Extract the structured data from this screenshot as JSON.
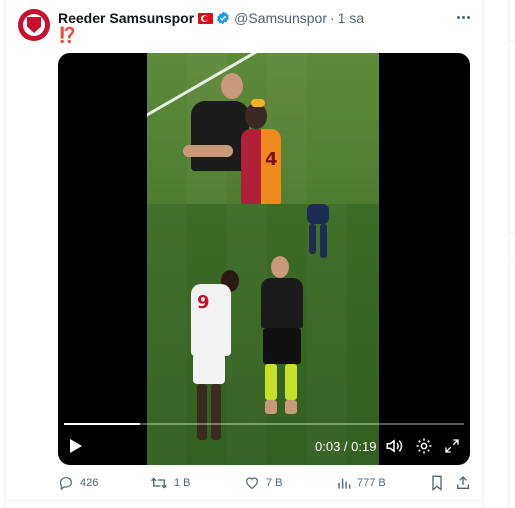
{
  "tweet": {
    "display_name": "Reeder Samsunspor",
    "handle": "@Samsunspor",
    "separator": "·",
    "time": "1 sa",
    "text": "⁉️",
    "flag_icon": "turkey-flag-icon",
    "verified_icon": "verified-badge-icon",
    "accent_color": "#1d9bf0"
  },
  "video": {
    "time_readout": "0:03 / 0:19",
    "progress": 0.19,
    "broadcaster_logo": "broadcaster-logo",
    "jersey_number_top": "4",
    "jersey_number_bottom": "9"
  },
  "actions": {
    "replies": "426",
    "reposts": "1 B",
    "likes": "7 B",
    "views": "777 B"
  }
}
